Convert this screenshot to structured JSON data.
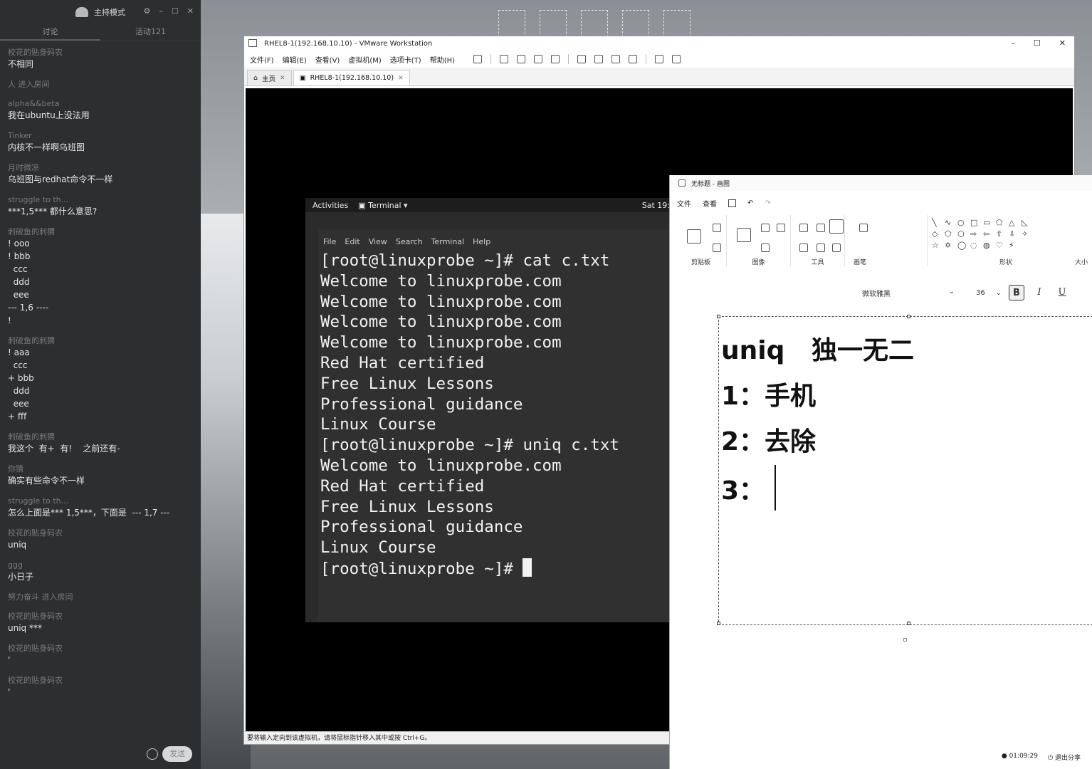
{
  "chat": {
    "mode_label": "主持模式",
    "tabs": [
      "讨论",
      "活动121"
    ],
    "messages": [
      {
        "nick": "校花的贴身码农",
        "lines": [
          "不相同"
        ]
      },
      {
        "nick": "人 进入房间",
        "lines": []
      },
      {
        "nick": "alpha&&beta",
        "lines": [
          "我在ubuntu上没法用"
        ]
      },
      {
        "nick": "Tinker",
        "lines": [
          "内核不一样啊乌班图"
        ]
      },
      {
        "nick": "月时微凉",
        "lines": [
          "乌班图与redhat命令不一样"
        ]
      },
      {
        "nick": "struggle to th...",
        "lines": [
          "***1,5*** 都什么意思?"
        ]
      },
      {
        "nick": "刺破鱼的刺猬",
        "lines": [
          "! ooo",
          "! bbb",
          "  ccc",
          "  ddd",
          "  eee",
          "--- 1,6 ----",
          "!"
        ]
      },
      {
        "nick": "刺破鱼的刺猬",
        "lines": [
          "! aaa",
          "  ccc",
          "+ bbb",
          "  ddd",
          "  eee",
          "+ fff"
        ]
      },
      {
        "nick": "刺破鱼的刺猬",
        "lines": [
          "我这个  有+  有!    之前还有-"
        ]
      },
      {
        "nick": "你猜",
        "lines": [
          "确实有些命令不一样"
        ]
      },
      {
        "nick": "struggle to th...",
        "lines": [
          "怎么上面是*** 1,5***，下面是  --- 1,7 ---"
        ]
      },
      {
        "nick": "校花的贴身码农",
        "lines": [
          "uniq"
        ]
      },
      {
        "nick": "ggg",
        "lines": [
          "小日子"
        ]
      },
      {
        "nick": "努力奋斗 进入房间",
        "lines": []
      },
      {
        "nick": "校花的贴身码农",
        "lines": [
          "uniq ***"
        ]
      },
      {
        "nick": "校花的贴身码农",
        "lines": [
          "'"
        ]
      },
      {
        "nick": "校花的贴身码农",
        "lines": [
          "'"
        ]
      }
    ],
    "send_label": "发送"
  },
  "vmware": {
    "title": "RHEL8-1(192.168.10.10) - VMware Workstation",
    "menu": [
      "文件(F)",
      "编辑(E)",
      "查看(V)",
      "虚拟机(M)",
      "选项卡(T)",
      "帮助(H)"
    ],
    "tabs": [
      "主页",
      "RHEL8-1(192.168.10.10)"
    ],
    "status_text": "要将输入定向到该虚拟机，请将鼠标指针移入其中或按 Ctrl+G。"
  },
  "gnome": {
    "activities": "Activities",
    "app_menu": "Terminal ▾",
    "clock": "Sat 19:"
  },
  "terminal": {
    "menu": [
      "File",
      "Edit",
      "View",
      "Search",
      "Terminal",
      "Help"
    ],
    "lines": [
      "[root@linuxprobe ~]# cat c.txt",
      "Welcome to linuxprobe.com",
      "Welcome to linuxprobe.com",
      "Welcome to linuxprobe.com",
      "Welcome to linuxprobe.com",
      "Red Hat certified",
      "Free Linux Lessons",
      "Professional guidance",
      "Linux Course",
      "[root@linuxprobe ~]# uniq c.txt",
      "Welcome to linuxprobe.com",
      "Red Hat certified",
      "Free Linux Lessons",
      "Professional guidance",
      "Linux Course"
    ],
    "prompt": "[root@linuxprobe ~]# "
  },
  "paint": {
    "title": "无标题 - 画图",
    "menu": [
      "文件",
      "查看"
    ],
    "groups": [
      "剪贴板",
      "图像",
      "工具",
      "画笔",
      "形状",
      "大小"
    ],
    "shapes": [
      "╲",
      "∿",
      "○",
      "□",
      "▭",
      "⬠",
      "△",
      "◺",
      "◇",
      "⬠",
      "⬡",
      "⇨",
      "⇦",
      "⇧",
      "⇩",
      "✧",
      "☆",
      "✡",
      "◯",
      "◌",
      "◍",
      "♡",
      "⚡"
    ],
    "font_name": "微软雅黑",
    "font_size": "36",
    "bold": "B",
    "italic": "I",
    "underline": "U",
    "text_lines": [
      "uniq   独一无二",
      "1：手机",
      "2：去除",
      "3："
    ],
    "time": "01:09:29",
    "exit_share": "退出分享"
  }
}
